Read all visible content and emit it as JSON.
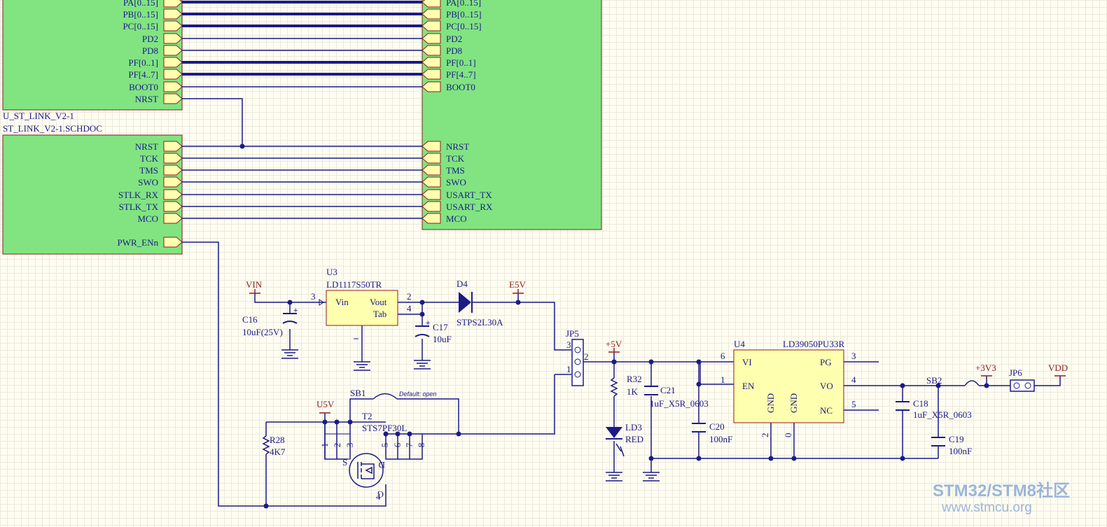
{
  "colors": {
    "block_fill": "#81e481",
    "block_stroke": "#802020",
    "wire": "#1b1b87",
    "bus": "#1b1b87",
    "text": "#1b1b87",
    "part_text": "#1b1b87",
    "power_text": "#8b1e1e",
    "ic_fill": "#ffffb0",
    "ic_stroke": "#8b1e1e",
    "watermark": "#9ab6da"
  },
  "left_block_top": {
    "ports": [
      "PA[0..15]",
      "PB[0..15]",
      "PC[0..15]",
      "PD2",
      "PD8",
      "PF[0..1]",
      "PF[4..7]",
      "BOOT0",
      "NRST"
    ]
  },
  "left_block_bottom": {
    "designator": "U_ST_LINK_V2-1",
    "filename": "ST_LINK_V2-1.SCHDOC",
    "ports": [
      "NRST",
      "TCK",
      "TMS",
      "SWO",
      "STLK_RX",
      "STLK_TX",
      "MCO",
      "PWR_ENn"
    ]
  },
  "right_block": {
    "ports_top": [
      "PA[0..15]",
      "PB[0..15]",
      "PC[0..15]",
      "PD2",
      "PD8",
      "PF[0..1]",
      "PF[4..7]",
      "BOOT0"
    ],
    "ports_bottom": [
      "NRST",
      "TCK",
      "TMS",
      "SWO",
      "USART_TX",
      "USART_RX",
      "MCO"
    ]
  },
  "u3": {
    "designator": "U3",
    "part": "LD1117S50TR",
    "pin_vin": "Vin",
    "pin_vout": "Vout",
    "pin_tab": "Tab",
    "pin_num_in": "3",
    "pin_num_out": "2",
    "pin_num_tab": "4"
  },
  "power": {
    "vin": "VIN",
    "e5v": "E5V",
    "p5v": "+5V",
    "u5v": "U5V",
    "p3v3": "+3V3",
    "vdd": "VDD"
  },
  "c16": {
    "designator": "C16",
    "value": "10uF(25V)"
  },
  "c17": {
    "designator": "C17",
    "value": "10uF"
  },
  "d4": {
    "designator": "D4",
    "value": "STPS2L30A"
  },
  "jp5": {
    "designator": "JP5",
    "pin1": "1",
    "pin2": "2",
    "pin3": "3"
  },
  "r32": {
    "designator": "R32",
    "value": "1K"
  },
  "c21": {
    "designator": "C21",
    "value": "1uF_X5R_0603"
  },
  "ld3": {
    "designator": "LD3",
    "value": "RED"
  },
  "c20": {
    "designator": "C20",
    "value": "100nF"
  },
  "u4": {
    "designator": "U4",
    "part": "LD39050PU33R",
    "pin_vi": "VI",
    "pin_en": "EN",
    "pin_pg": "PG",
    "pin_vo": "VO",
    "pin_nc": "NC",
    "pin_gnd1": "GND",
    "pin_gnd2": "GND",
    "num_vi": "6",
    "num_en": "1",
    "num_pg": "3",
    "num_vo": "4",
    "num_nc": "5",
    "num_gnd1": "2",
    "num_gnd2": "0"
  },
  "c18": {
    "designator": "C18",
    "value": "1uF_X5R_0603"
  },
  "c19": {
    "designator": "C19",
    "value": "100nF"
  },
  "sb2": {
    "designator": "SB2"
  },
  "jp6": {
    "designator": "JP6"
  },
  "sb1": {
    "designator": "SB1",
    "note": "Default: open"
  },
  "t2": {
    "designator": "T2",
    "part": "STS7PF30L",
    "pins": [
      "1",
      "2",
      "3",
      "5",
      "6",
      "7",
      "8",
      "4"
    ],
    "s": "S",
    "d": "D",
    "g": "G"
  },
  "r28": {
    "designator": "R28",
    "value": "4K7"
  },
  "watermark": {
    "line1": "STM32/STM8社区",
    "line2": "www.stmcu.org"
  }
}
